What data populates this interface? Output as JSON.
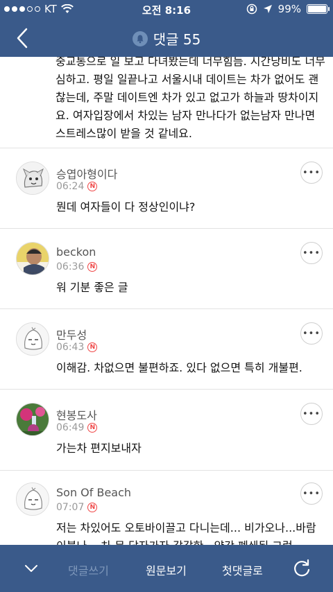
{
  "status_bar": {
    "carrier": "KT",
    "time": "오전 8:16",
    "battery": "99%",
    "battery_level": 0.99
  },
  "header": {
    "title": "댓글 55"
  },
  "previous_comment_text": "중교통으로 일 보고 다녀봤는데 너무힘듬. 시간낭비도 너무 심하고. 평일 일끝나고 서울시내 데이트는 차가 없어도 괜찮는데, 주말 데이트엔 차가 있고 없고가 하늘과 땅차이지요. 여자입장에서 차있는 남자 만나다가 없는남자 만나면 스트레스많이 받을 것 같네요.",
  "comments": [
    {
      "author": "승엽아형이다",
      "time": "06:24",
      "badge": "N",
      "text": "뭔데 여자들이 다 정상인이냐?"
    },
    {
      "author": "beckon",
      "time": "06:36",
      "badge": "N",
      "text": "워 기분 좋은 글"
    },
    {
      "author": "만두성",
      "time": "06:43",
      "badge": "N",
      "text": "이해감. 차없으면 불편하죠. 있다 없으면 특히 개불편."
    },
    {
      "author": "현봉도사",
      "time": "06:49",
      "badge": "N",
      "text": "가는차 편지보내자"
    },
    {
      "author": "Son Of Beach",
      "time": "07:07",
      "badge": "N",
      "text": "저는 차있어도 오토바이끌고 다니는데... 비가오나...바람이불나... 차 문 닫자가자 갑갑한.. 약간 폐쇄된 그런"
    }
  ],
  "bottom_bar": {
    "write_label": "댓글쓰기",
    "origin_label": "원문보기",
    "first_label": "첫댓글로"
  },
  "icons": {
    "back": "chevron-left-icon",
    "bell": "bell-icon",
    "more": "more-icon",
    "down": "chevron-down-icon",
    "refresh": "refresh-icon",
    "n_badge": "n-badge-icon"
  },
  "colors": {
    "header_bg": "#3a5a8a",
    "bottom_bg": "#3a5a8a",
    "badge_red": "#ef4444"
  }
}
